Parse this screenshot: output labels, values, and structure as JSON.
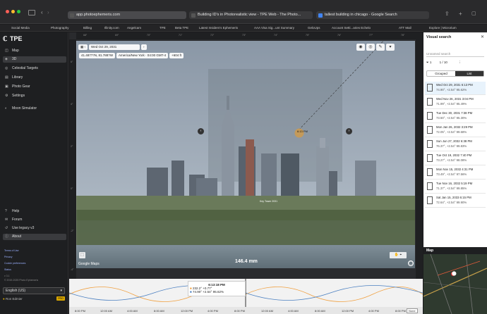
{
  "browser": {
    "url": "app.photoephemeris.com",
    "tabs": [
      {
        "label": "Building ID's in Photorealistic view - TPE Web - The Photo..."
      },
      {
        "label": "tallest building in chicago - Google Search"
      }
    ],
    "bookmarks": [
      "Social Media",
      "Photography",
      "Billing",
      "Illinity.com",
      "Angelcam",
      "TPE",
      "Beta TPE",
      "Latest Insiders's Ephemeris",
      "AAA Visa Sig...unt Summary",
      "GeloUps",
      "Account Setti...aries Echelo",
      "ATT Mail",
      "Explore | Microrium"
    ]
  },
  "sidebar": {
    "logo": "TPE",
    "items": [
      {
        "label": "Map",
        "icon": "map-icon"
      },
      {
        "label": "3D",
        "icon": "cube-icon"
      },
      {
        "label": "Celestial Targets",
        "icon": "target-icon"
      },
      {
        "label": "Library",
        "icon": "library-icon"
      },
      {
        "label": "Photo Gear",
        "icon": "camera-icon"
      },
      {
        "label": "Settings",
        "icon": "gear-icon"
      },
      {
        "label": "Moon Simulator",
        "icon": "moon-icon"
      }
    ],
    "bottom_items": [
      {
        "label": "Help",
        "icon": "help-icon"
      },
      {
        "label": "Forum",
        "icon": "forum-icon"
      },
      {
        "label": "Use legacy v3",
        "icon": "legacy-icon"
      },
      {
        "label": "About",
        "icon": "info-icon"
      }
    ],
    "links": [
      "Terms of Use",
      "Privacy",
      "Cookie preferences",
      "Status"
    ],
    "version": "v 3.1",
    "copyright": "© 2019-2025 Photo Ephemeris",
    "language": "English (US)",
    "user": "Ron Edmier",
    "badge": "PRO"
  },
  "main": {
    "date": "Wed Oct 29, 2031",
    "toolbar": {
      "coords": "41.487??N, 81.788?W",
      "timezone": "America/New York · 04:00 GMT-4",
      "elevation": "+604 ft"
    },
    "moon_label": "6:13 PM",
    "building_label": "Key Tower 2031",
    "focal_length": "146.4 mm",
    "google_label": "Google Maps",
    "ruler_top": [
      "68°",
      "69°",
      "70°",
      "71°",
      "72°",
      "73°",
      "74°",
      "75°",
      "76°",
      "77°",
      "78°"
    ],
    "ruler_left": [
      "6°",
      "4°",
      "2°",
      "0°",
      "-2°",
      "-4°"
    ]
  },
  "timeline": {
    "times": [
      "8:00 PM",
      "12:00 AM",
      "4:00 AM",
      "8:00 AM",
      "12:00 PM",
      "4:00 PM",
      "8:00 PM",
      "12:00 AM",
      "4:00 AM",
      "8:00 AM",
      "12:00 PM",
      "4:00 PM",
      "8:00 PM"
    ],
    "tooltip_time": "6:13:18 PM",
    "sun_row": "232.2°  +0.77°",
    "moon_row": "74.90°  +2.54°  95.62%",
    "zoom": "None"
  },
  "right_panel": {
    "title": "Visual search",
    "search_placeholder": "Unnamed search",
    "filter_count": "1",
    "page_info": "1 / 10",
    "segments": [
      "Grouped",
      "List"
    ],
    "results": [
      {
        "date": "Wed Oct 29, 2031 6:13 PM",
        "values": "74.90°, +2.54° 95.62%"
      },
      {
        "date": "Wed Nov 26, 2031 3:04 PM",
        "values": "71.99°, +2.54° 95.49%"
      },
      {
        "date": "Tue Dec 30, 2031 7:38 PM",
        "values": "73.50°, +2.54° 95.30%"
      },
      {
        "date": "Mon Jan 26, 2032 3:29 PM",
        "values": "72.05°, +2.54° 99.68%"
      },
      {
        "date": "Sun Jun 27, 2032 6:38 PM",
        "values": "76.37°, +2.54° 99.83%"
      },
      {
        "date": "Tue Oct 19, 2032 7:40 PM",
        "values": "73.27°, +2.54° 98.08%"
      },
      {
        "date": "Mon Nov 15, 2032 4:31 PM",
        "values": "73.49°, +2.54° 97.56%"
      },
      {
        "date": "Tue Nov 16, 2032 5:19 PM",
        "values": "71.37°, +2.54° 99.85%"
      },
      {
        "date": "Sat Jan 15, 2033 6:15 PM",
        "values": "72.64°, +2.54° 99.90%"
      }
    ],
    "map_title": "Map"
  }
}
